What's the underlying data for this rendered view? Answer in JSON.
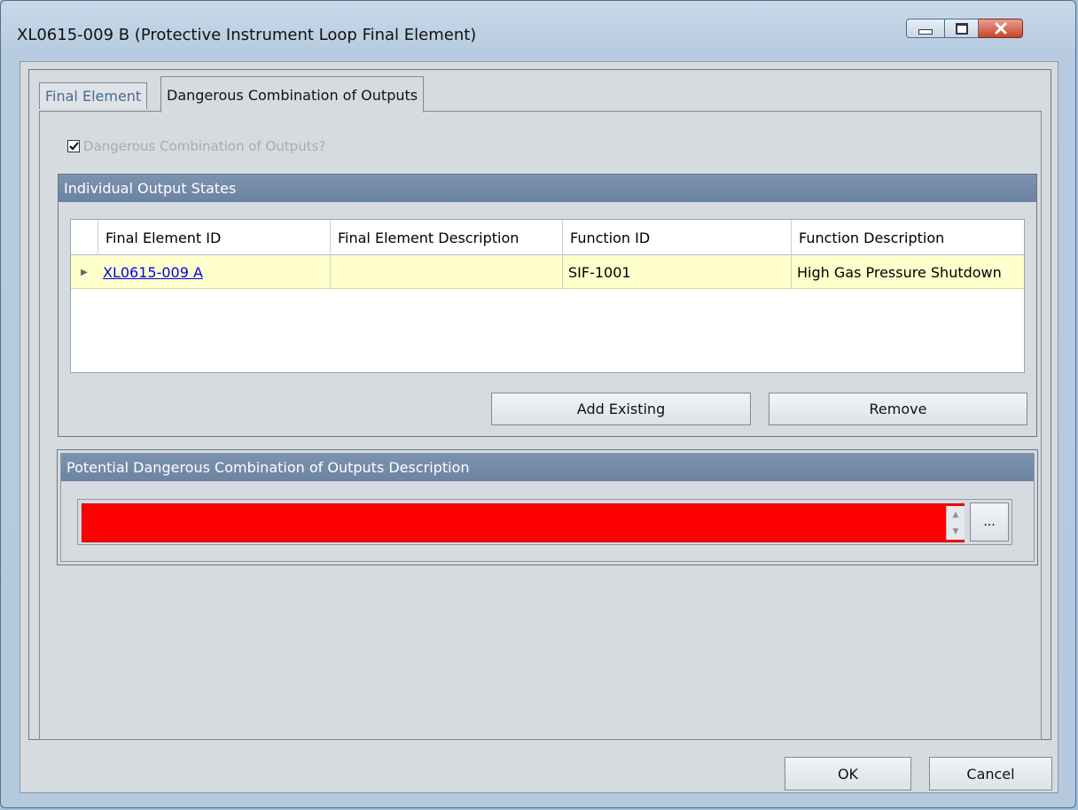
{
  "window": {
    "title": "XL0615-009 B (Protective Instrument Loop Final Element)",
    "controls": {
      "minimize": "minimize-icon",
      "maximize": "maximize-icon",
      "close": "close-icon"
    }
  },
  "tabs": [
    {
      "label": "Final Element",
      "active": false
    },
    {
      "label": "Dangerous Combination of Outputs",
      "active": true
    }
  ],
  "dangerous_checkbox": {
    "label": "Dangerous Combination of Outputs?",
    "checked": true
  },
  "output_states": {
    "header": "Individual Output States",
    "columns": [
      "Final Element ID",
      "Final Element Description",
      "Function ID",
      "Function Description"
    ],
    "rows": [
      {
        "final_element_id": "XL0615-009 A",
        "final_element_description": "",
        "function_id": "SIF-1001",
        "function_description": "High Gas Pressure Shutdown"
      }
    ],
    "add_existing_label": "Add Existing",
    "remove_label": "Remove"
  },
  "description_section": {
    "header": "Potential Dangerous Combination of Outputs Description",
    "value": "",
    "ellipsis_label": "...",
    "field_color": "#ff0000"
  },
  "footer": {
    "ok_label": "OK",
    "cancel_label": "Cancel"
  }
}
